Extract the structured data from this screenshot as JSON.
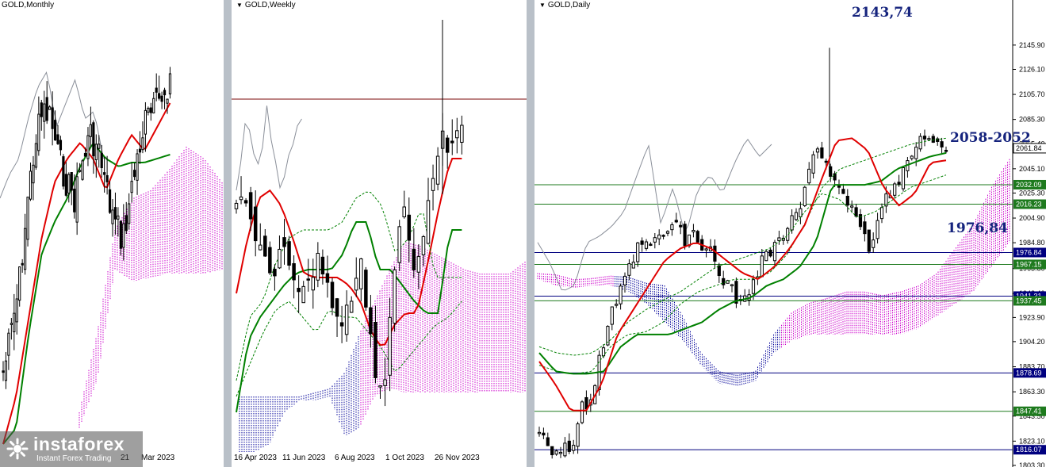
{
  "panels": {
    "monthly": {
      "title": "GOLD,Monthly",
      "xlabels": [
        "Mar 2023"
      ],
      "xlabel_partial": "21"
    },
    "weekly": {
      "title": "GOLD,Weekly",
      "xlabels": [
        "16 Apr 2023",
        "11 Jun 2023",
        "6 Aug 2023",
        "1 Oct 2023",
        "26 Nov 2023"
      ]
    },
    "daily": {
      "title": "GOLD,Daily"
    }
  },
  "annotations": {
    "high": "2143,74",
    "zone": "2058-2052",
    "level": "1976,84"
  },
  "logo": {
    "brand": "instaforex",
    "tagline": "Instant Forex Trading"
  },
  "colors": {
    "bull": "#000000",
    "tenkan": "#e00000",
    "kijun": "#008000",
    "chikou": "#8a8f99",
    "kumo_bear": "#cc00cc",
    "kumo_bull": "#000099",
    "level_green": "#1e7a1e",
    "level_blue": "#00007f",
    "label_text": "#ffffff"
  },
  "chart_data": {
    "type": "candlestick",
    "symbol": "GOLD",
    "timeframe": "Daily",
    "y_axis": {
      "ylim": [
        1803.3,
        2165.2
      ],
      "ticks": [
        "2145.90",
        "2126.10",
        "2105.70",
        "2085.30",
        "2065.40",
        "2045.10",
        "2025.30",
        "2004.90",
        "1984.80",
        "1963.80",
        "1943.40",
        "1923.90",
        "1904.20",
        "1883.70",
        "1863.30",
        "1843.50",
        "1823.10",
        "1803.30"
      ]
    },
    "level_labels": [
      {
        "text": "2061.84",
        "value": 2061.84,
        "style": "current"
      },
      {
        "text": "2032.09",
        "value": 2032.09,
        "style": "green"
      },
      {
        "text": "2016.23",
        "value": 2016.23,
        "style": "green"
      },
      {
        "text": "1976.84",
        "value": 1976.84,
        "style": "blue"
      },
      {
        "text": "1967.15",
        "value": 1967.15,
        "style": "green"
      },
      {
        "text": "1941.31",
        "value": 1941.31,
        "style": "blue"
      },
      {
        "text": "1937.45",
        "value": 1937.45,
        "style": "green"
      },
      {
        "text": "1878.69",
        "value": 1878.69,
        "style": "blue"
      },
      {
        "text": "1847.41",
        "value": 1847.41,
        "style": "green"
      },
      {
        "text": "1816.07",
        "value": 1816.07,
        "style": "blue"
      }
    ],
    "annotated_high": 2143.74,
    "annotated_zone": [
      2058,
      2052
    ],
    "series": [
      {
        "name": "Tenkan-sen",
        "color": "#e00000"
      },
      {
        "name": "Kijun-sen",
        "color": "#008000"
      },
      {
        "name": "Chikou Span",
        "color": "#8a8f99"
      },
      {
        "name": "Senkou Span cloud",
        "color": "#cc00cc"
      }
    ]
  }
}
